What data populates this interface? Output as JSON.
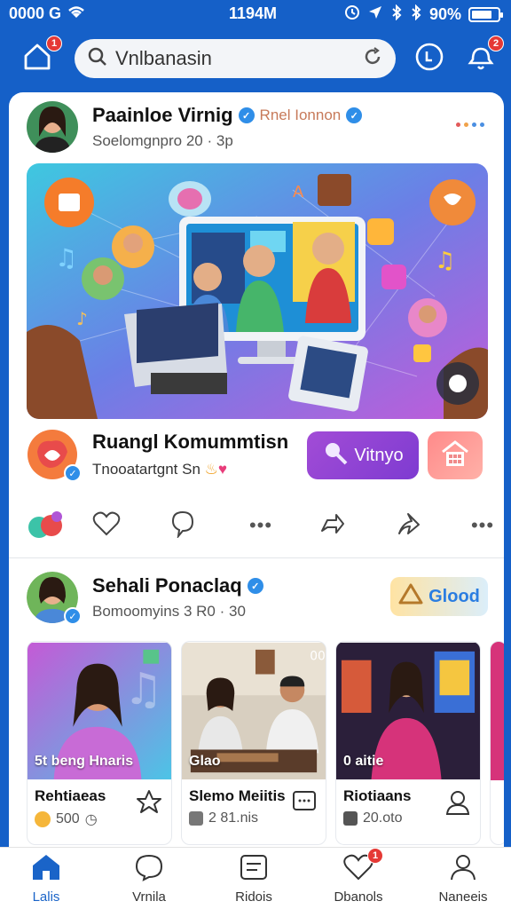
{
  "status_bar": {
    "left_text": "0000 G",
    "time": "1194M",
    "battery_pct": "90%"
  },
  "top_bar": {
    "home_badge": "1",
    "search_placeholder": "Vnlbanasin",
    "notif_badge": "2"
  },
  "post1": {
    "author": "Paainloe Virnig",
    "tag": "Rnel Ionnon",
    "subtitle": "Soelomgnpro 20 · 3p",
    "community": {
      "title": "Ruangl Komummtisn",
      "subtitle": "Tnooatartgnt  Sn",
      "join_label": "Vitnyo"
    }
  },
  "post2": {
    "author": "Sehali Ponaclaq",
    "subtitle": "Bomoomyins 3 R0 · 30",
    "gold_label": "Glood"
  },
  "cards": [
    {
      "overlay": "5t beng  Hnaris",
      "title": "Rehtiaeas",
      "meta": "500"
    },
    {
      "overlay": "Glao",
      "title": "Slemo Meiitis",
      "meta": "2 81.nis"
    },
    {
      "overlay": "0 aitie",
      "title": "Riotiaans",
      "meta": "20.oto"
    }
  ],
  "bottom_nav": [
    {
      "label": "Lalis",
      "active": true
    },
    {
      "label": "Vrnila"
    },
    {
      "label": "Ridois"
    },
    {
      "label": "Dbanols",
      "badge": "1"
    },
    {
      "label": "Naneeis"
    }
  ],
  "colors": {
    "brand_blue": "#1560c8",
    "accent_purple": "#8b44d4",
    "verified": "#2f8ee8"
  }
}
